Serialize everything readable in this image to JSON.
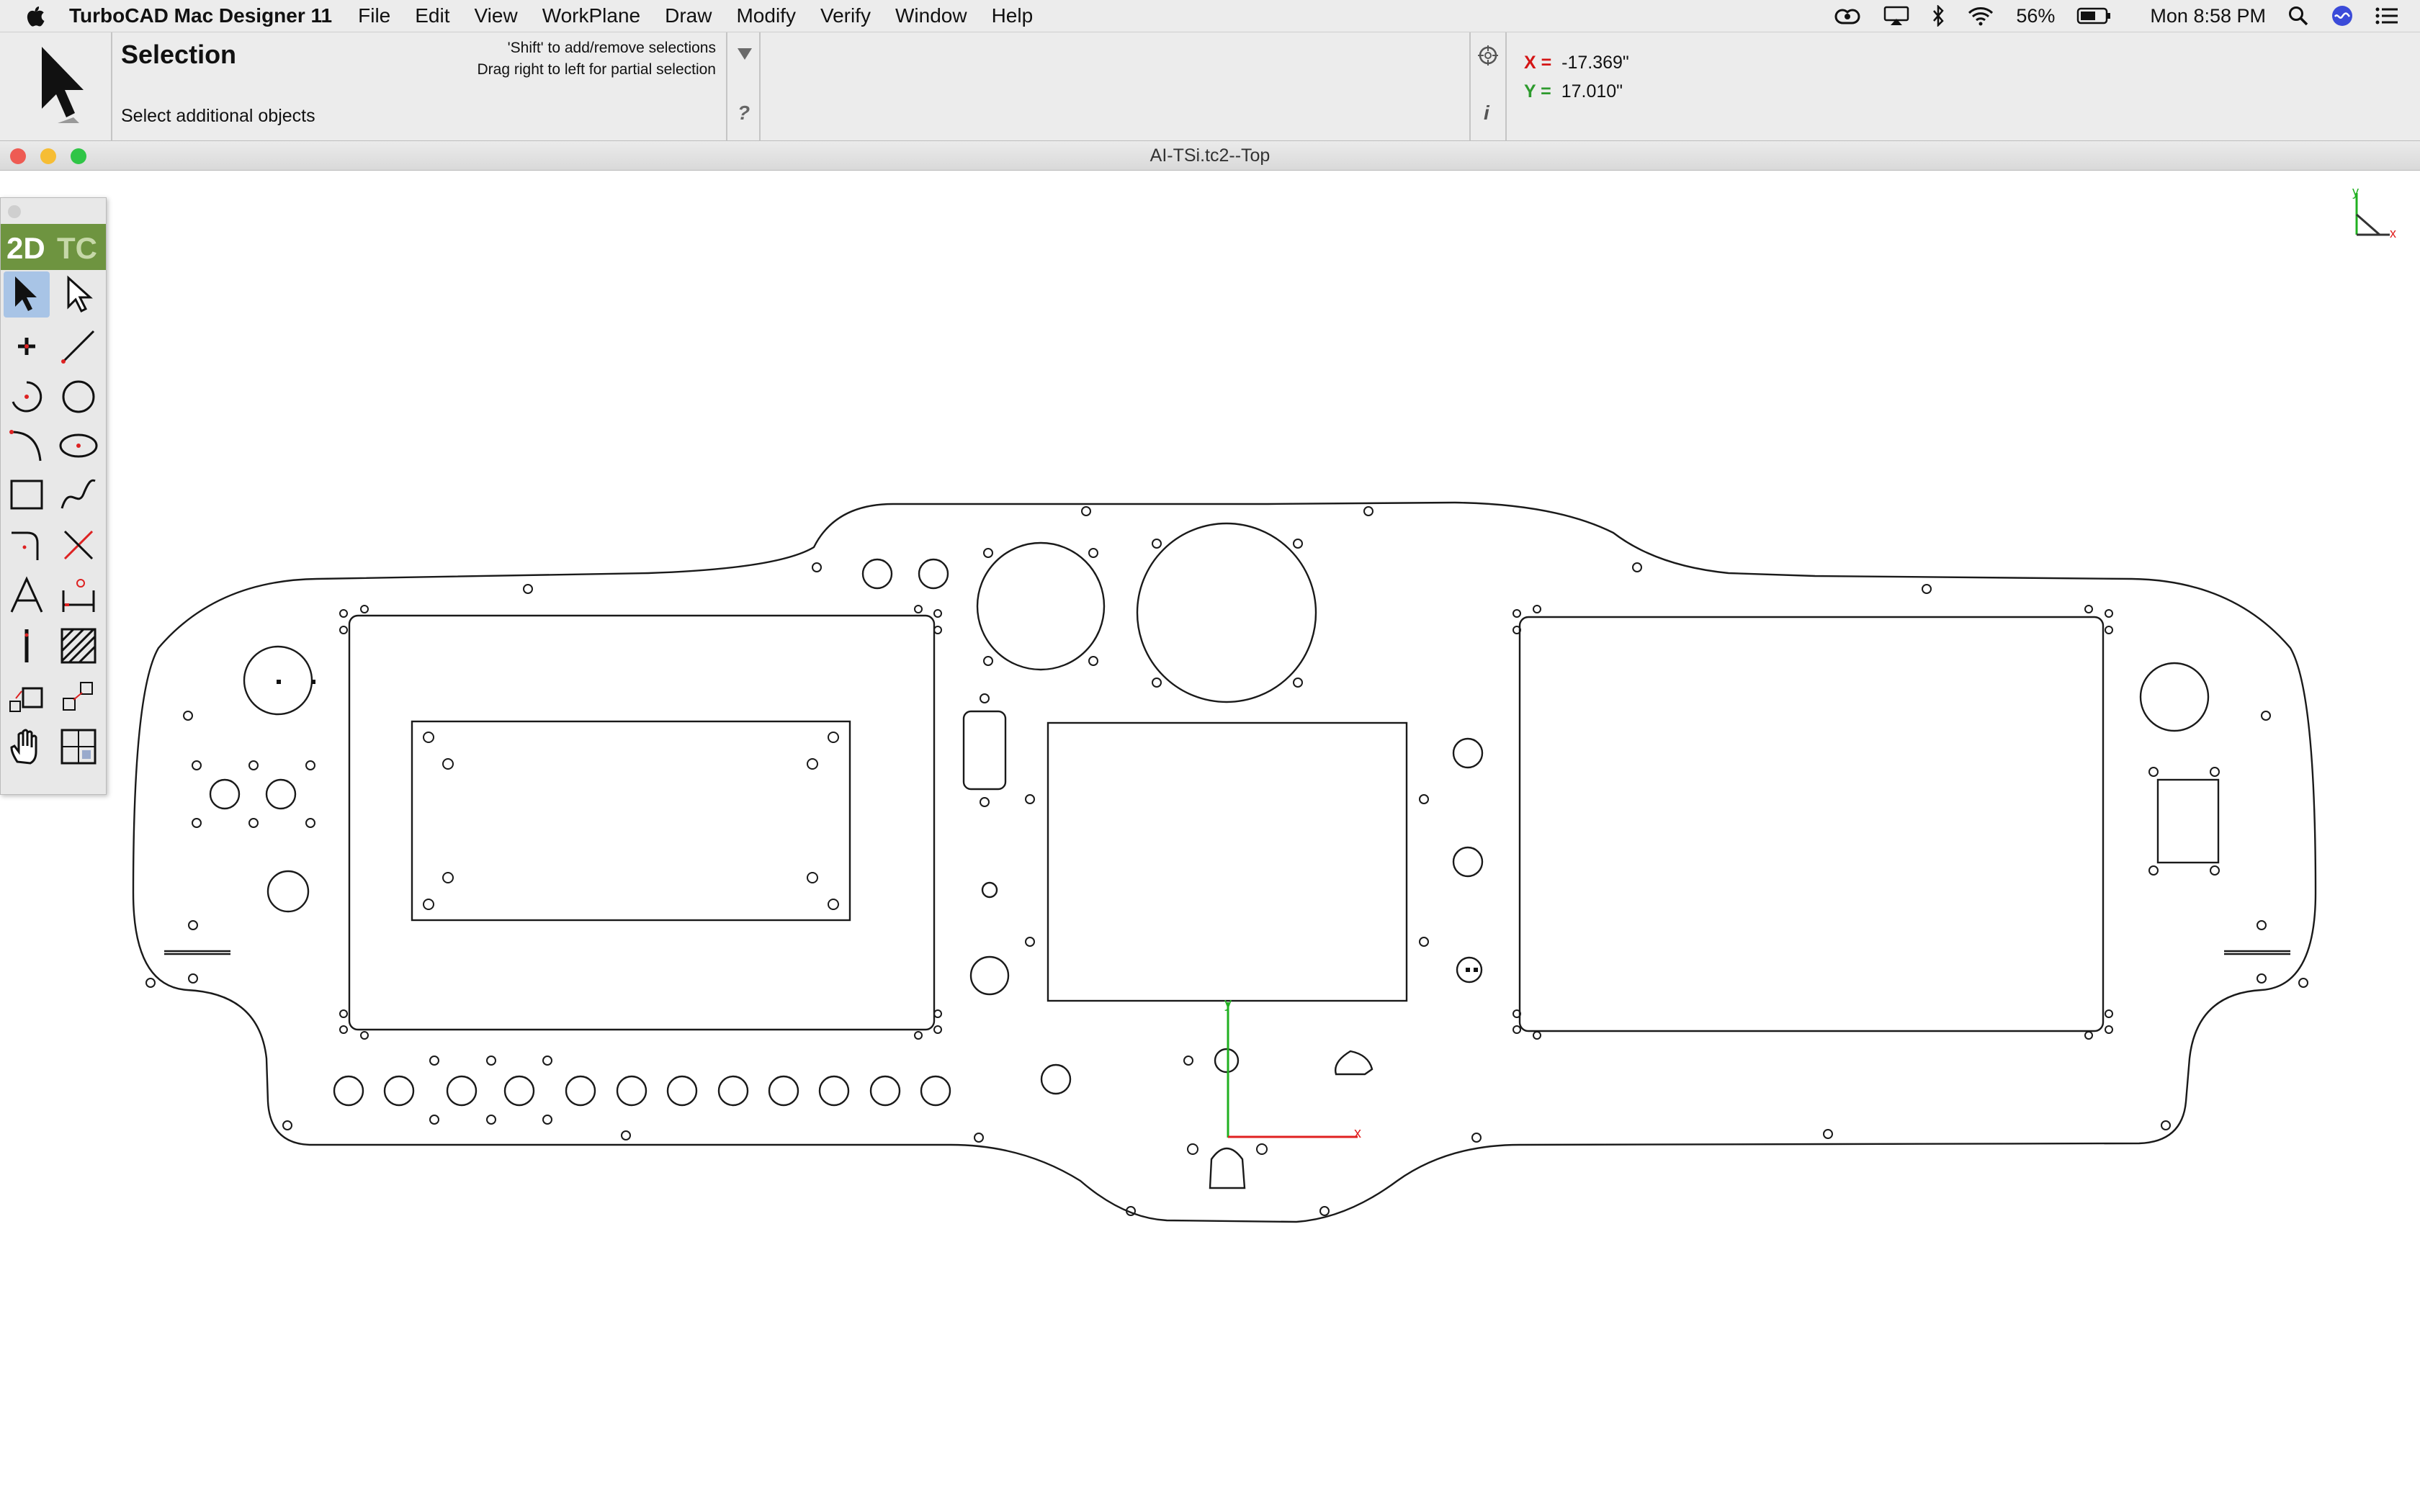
{
  "menubar": {
    "app_name": "TurboCAD Mac Designer 11",
    "items": [
      "File",
      "Edit",
      "View",
      "WorkPlane",
      "Draw",
      "Modify",
      "Verify",
      "Window",
      "Help"
    ],
    "battery": "56%",
    "clock": "Mon 8:58 PM"
  },
  "toolbar": {
    "tool_name": "Selection",
    "hint": "Select additional objects",
    "tip_line1": "'Shift' to add/remove selections",
    "tip_line2": "Drag right to left for partial selection",
    "help_label": "?",
    "info_label": "i",
    "x_label": "X =",
    "x_value": "-17.369\"",
    "y_label": "Y =",
    "y_value": "17.010\""
  },
  "document": {
    "title": "AI-TSi.tc2--Top"
  },
  "palette": {
    "header_2d": "2D",
    "header_tc": "TC",
    "tools": [
      "select",
      "edit-tool",
      "point",
      "line",
      "arc",
      "circle",
      "curve",
      "ellipse",
      "rectangle",
      "spline",
      "fillet",
      "trim",
      "text",
      "dimension",
      "construction-line",
      "hatch",
      "copy",
      "transform",
      "pan",
      "view"
    ]
  },
  "axis": {
    "x_label": "x",
    "y_label": "y"
  },
  "colors": {
    "x_axis": "#e02020",
    "y_axis": "#20b020",
    "palette_header": "#6e9440",
    "selected_tool": "#a8c4e6"
  }
}
